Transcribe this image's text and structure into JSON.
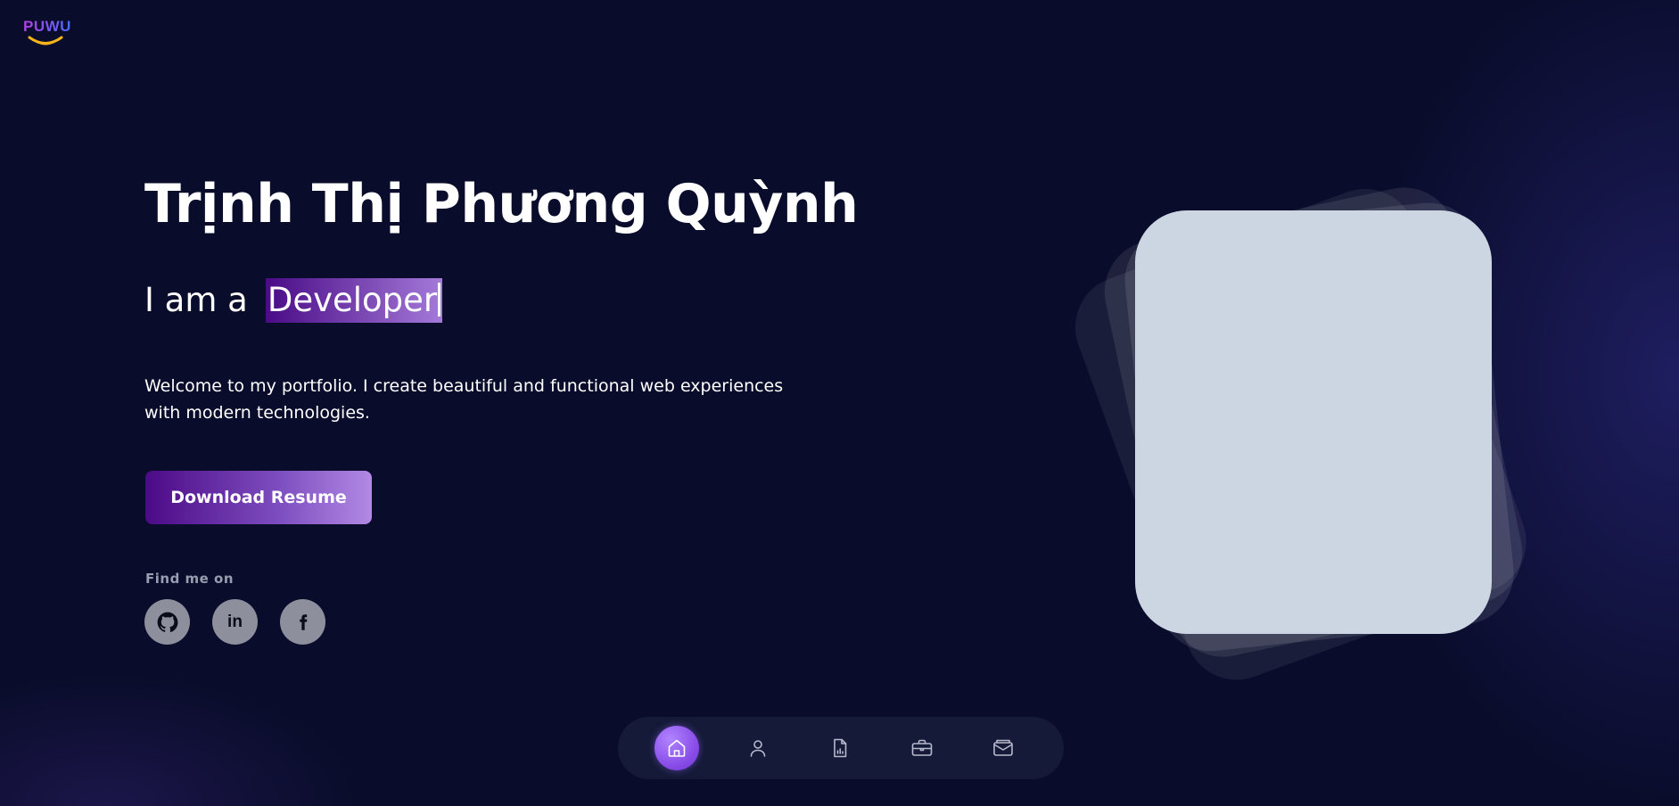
{
  "logo": {
    "text": "PUWU"
  },
  "hero": {
    "name": "Trịnh Thị Phương Quỳnh",
    "role_prefix": "I am a",
    "role_highlight": "Developer",
    "intro": "Welcome to my portfolio. I create beautiful and functional web experiences with modern technologies.",
    "download_label": "Download Resume"
  },
  "socials": {
    "heading": "Find me on",
    "items": [
      {
        "name": "GitHub",
        "icon": "github-icon"
      },
      {
        "name": "LinkedIn",
        "icon": "linkedin-icon"
      },
      {
        "name": "Facebook",
        "icon": "facebook-icon"
      }
    ]
  },
  "nav": {
    "items": [
      {
        "icon": "home-icon",
        "active": true
      },
      {
        "icon": "user-icon",
        "active": false
      },
      {
        "icon": "document-chart-icon",
        "active": false
      },
      {
        "icon": "briefcase-icon",
        "active": false
      },
      {
        "icon": "mail-icon",
        "active": false
      }
    ]
  },
  "colors": {
    "background": "#090c2a",
    "accent_start": "#4c0a86",
    "accent_end": "#b289e4",
    "photo_placeholder": "#cbd6e2",
    "nav_active": "#8a4fe8"
  }
}
